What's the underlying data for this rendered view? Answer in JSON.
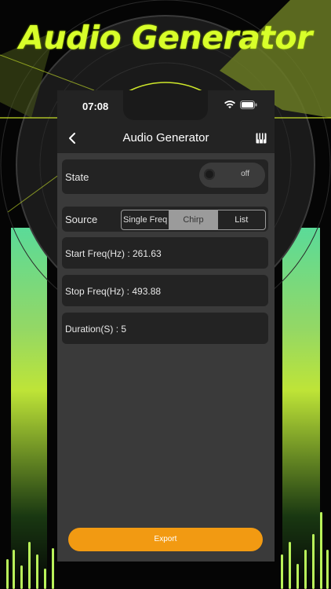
{
  "promo": {
    "title": "Audio Generator"
  },
  "status_bar": {
    "time": "07:08"
  },
  "nav": {
    "title": "Audio Generator",
    "back_icon": "chevron-left-icon",
    "menu_icon": "piano-icon"
  },
  "state_row": {
    "label": "State",
    "toggle_text": "off",
    "toggle_on": false
  },
  "source_row": {
    "label": "Source",
    "options": [
      "Single Freq",
      "Chirp",
      "List"
    ],
    "selected": "Chirp"
  },
  "fields": {
    "start_freq": "Start Freq(Hz) : 261.63",
    "stop_freq": "Stop Freq(Hz) : 493.88",
    "duration": "Duration(S) : 5"
  },
  "export": {
    "label": "Export"
  },
  "colors": {
    "accent": "#f29a12",
    "title": "#d8ff2a",
    "card": "#232323",
    "screen": "#3a3a3a"
  }
}
